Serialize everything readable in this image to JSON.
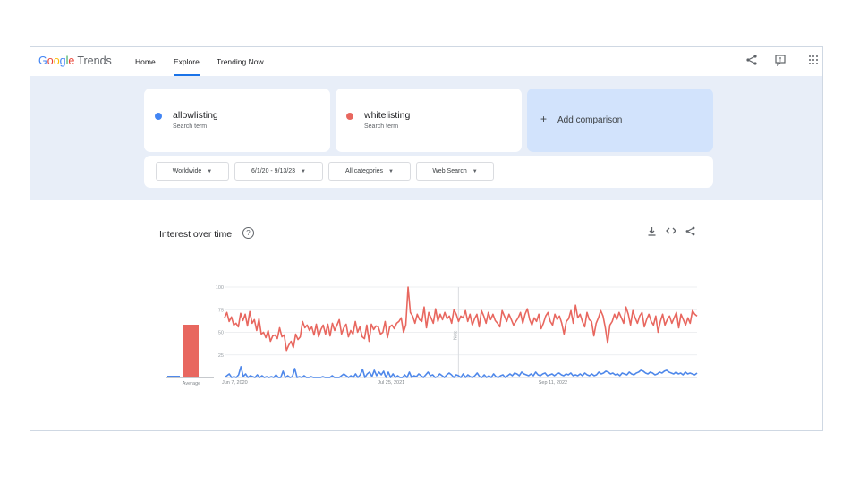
{
  "app": {
    "logo_google": "Google",
    "logo_trends": "Trends",
    "nav": [
      "Home",
      "Explore",
      "Trending Now"
    ],
    "topbar_icons": [
      "share-icon",
      "feedback-icon",
      "apps-grid-icon"
    ]
  },
  "terms": [
    {
      "name": "allowlisting",
      "subtitle": "Search term",
      "color": "#4285f4"
    },
    {
      "name": "whitelisting",
      "subtitle": "Search term",
      "color": "#e8675f"
    }
  ],
  "add_comparison": "Add comparison",
  "filters": {
    "region": "Worldwide",
    "date_range": "6/1/20 - 9/13/23",
    "category": "All categories",
    "search_type": "Web Search"
  },
  "interest_card": {
    "title": "Interest over time",
    "icons": [
      "download-icon",
      "embed-icon",
      "share-icon"
    ],
    "average_label": "Average",
    "note_label": "Note"
  },
  "chart_data": {
    "type": "line",
    "title": "Interest over time",
    "x_tick_labels": [
      "Jun 7, 2020",
      "Jul 25, 2021",
      "Sep 11, 2022"
    ],
    "y_ticks": [
      25,
      50,
      75,
      100
    ],
    "ylim": [
      0,
      100
    ],
    "grid": true,
    "averages": [
      {
        "name": "allowlisting",
        "value": 2
      },
      {
        "name": "whitelisting",
        "value": 60
      }
    ],
    "series": [
      {
        "name": "whitelisting",
        "color": "#e8675f",
        "values": [
          66,
          72,
          62,
          67,
          58,
          60,
          56,
          71,
          63,
          70,
          57,
          73,
          60,
          64,
          52,
          65,
          48,
          50,
          44,
          52,
          40,
          46,
          47,
          43,
          55,
          45,
          47,
          30,
          36,
          40,
          33,
          48,
          42,
          45,
          62,
          55,
          58,
          52,
          56,
          47,
          59,
          45,
          53,
          58,
          48,
          59,
          46,
          60,
          52,
          58,
          64,
          48,
          55,
          59,
          45,
          52,
          48,
          62,
          50,
          56,
          45,
          43,
          58,
          40,
          59,
          53,
          57,
          56,
          48,
          50,
          62,
          44,
          56,
          58,
          54,
          60,
          62,
          66,
          50,
          58,
          100,
          72,
          68,
          60,
          70,
          64,
          62,
          78,
          55,
          72,
          66,
          60,
          76,
          62,
          70,
          64,
          72,
          65,
          68,
          60,
          75,
          70,
          62,
          68,
          66,
          74,
          62,
          70,
          58,
          65,
          70,
          56,
          74,
          68,
          60,
          72,
          64,
          70,
          63,
          60,
          56,
          74,
          68,
          62,
          70,
          64,
          58,
          62,
          66,
          72,
          60,
          70,
          76,
          64,
          58,
          66,
          62,
          70,
          54,
          60,
          68,
          72,
          62,
          58,
          70,
          64,
          68,
          60,
          48,
          62,
          65,
          74,
          60,
          80,
          66,
          70,
          62,
          56,
          72,
          64,
          62,
          46,
          60,
          66,
          74,
          68,
          55,
          38,
          58,
          62,
          70,
          64,
          72,
          66,
          60,
          78,
          70,
          58,
          74,
          66,
          60,
          68,
          72,
          56,
          64,
          70,
          62,
          58,
          68,
          50,
          62,
          70,
          58,
          64,
          68,
          60,
          66,
          72,
          55,
          70,
          64,
          58,
          66,
          60,
          74,
          70,
          68
        ]
      },
      {
        "name": "allowlisting",
        "color": "#4f88ea",
        "values": [
          0,
          2,
          4,
          0,
          1,
          0,
          3,
          12,
          1,
          4,
          0,
          2,
          1,
          0,
          3,
          0,
          2,
          0,
          1,
          0,
          1,
          0,
          3,
          0,
          0,
          7,
          0,
          2,
          0,
          1,
          10,
          0,
          1,
          0,
          2,
          0,
          0,
          1,
          0,
          0,
          0,
          0,
          1,
          0,
          0,
          0,
          2,
          0,
          0,
          0,
          2,
          4,
          2,
          0,
          2,
          0,
          4,
          0,
          3,
          9,
          0,
          4,
          6,
          1,
          8,
          2,
          6,
          3,
          7,
          0,
          6,
          0,
          4,
          0,
          2,
          0,
          0,
          3,
          0,
          6,
          0,
          2,
          1,
          4,
          2,
          0,
          3,
          6,
          2,
          3,
          0,
          1,
          4,
          2,
          0,
          3,
          5,
          3,
          0,
          3,
          2,
          0,
          4,
          0,
          3,
          1,
          0,
          2,
          5,
          1,
          0,
          3,
          0,
          2,
          0,
          4,
          1,
          0,
          2,
          3,
          0,
          2,
          4,
          2,
          5,
          4,
          2,
          6,
          4,
          3,
          2,
          4,
          2,
          6,
          3,
          2,
          4,
          5,
          2,
          3,
          4,
          2,
          4,
          5,
          3,
          2,
          4,
          3,
          5,
          2,
          3,
          2,
          4,
          2,
          5,
          3,
          2,
          4,
          2,
          3,
          6,
          4,
          5,
          7,
          6,
          4,
          5,
          3,
          4,
          2,
          5,
          4,
          3,
          6,
          4,
          3,
          5,
          6,
          8,
          7,
          5,
          4,
          6,
          5,
          3,
          4,
          6,
          5,
          7,
          8,
          6,
          5,
          4,
          6,
          4,
          5,
          3,
          6,
          4,
          5,
          4,
          3,
          5
        ]
      }
    ]
  }
}
